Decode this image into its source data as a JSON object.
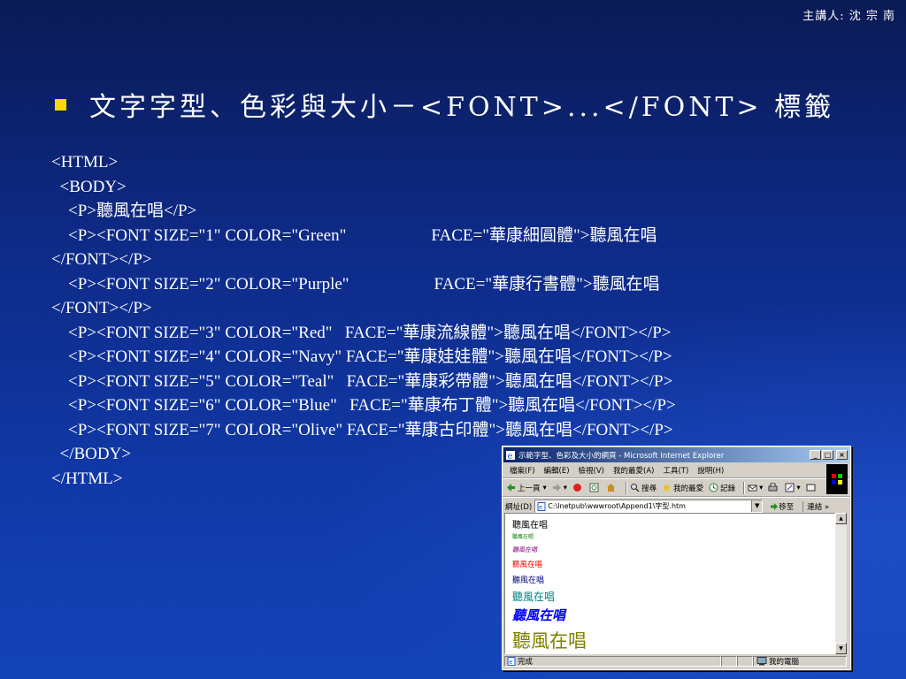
{
  "slide": {
    "speaker": "主講人: 沈 宗 南",
    "title": "文字字型、色彩與大小－<FONT>...</FONT> 標籤"
  },
  "code": {
    "l1": "<HTML>",
    "l2": "  <BODY>",
    "l3": "    <P>聽風在唱</P>",
    "l4a": "    <P><FONT SIZE=\"1\" COLOR=\"Green\"",
    "l4b": "FACE=\"華康細圓體\">聽風在唱",
    "l5": "</FONT></P>",
    "l6a": "    <P><FONT SIZE=\"2\" COLOR=\"Purple\"",
    "l6b": "FACE=\"華康行書體\">聽風在唱",
    "l7": "</FONT></P>",
    "l8": "    <P><FONT SIZE=\"3\" COLOR=\"Red\"   FACE=\"華康流線體\">聽風在唱</FONT></P>",
    "l9": "    <P><FONT SIZE=\"4\" COLOR=\"Navy\" FACE=\"華康娃娃體\">聽風在唱</FONT></P>",
    "l10": "    <P><FONT SIZE=\"5\" COLOR=\"Teal\"   FACE=\"華康彩帶體\">聽風在唱</FONT></P>",
    "l11": "    <P><FONT SIZE=\"6\" COLOR=\"Blue\"   FACE=\"華康布丁體\">聽風在唱</FONT></P>",
    "l12": "    <P><FONT SIZE=\"7\" COLOR=\"Olive\" FACE=\"華康古印體\">聽風在唱</FONT></P>",
    "l13": "  </BODY>",
    "l14": "</HTML>"
  },
  "browser": {
    "title": "示範字型、色彩及大小的網頁 - Microsoft Internet Explorer",
    "menu": [
      "檔案(F)",
      "編輯(E)",
      "檢視(V)",
      "我的最愛(A)",
      "工具(T)",
      "說明(H)"
    ],
    "toolbar": {
      "back": "上一頁",
      "search": "搜尋",
      "favorites": "我的最愛",
      "history": "記錄"
    },
    "address_label": "網址(D)",
    "address": "C:\\Inetpub\\wwwroot\\Append1\\字型.htm",
    "go": "移至",
    "links": "連結",
    "status_left": "完成",
    "status_right": "我的電腦",
    "page_lines": [
      {
        "text": "聽風在唱",
        "color": "#000000"
      },
      {
        "text": "聽風在唱",
        "color": "#008000"
      },
      {
        "text": "聽風在唱",
        "color": "#800080"
      },
      {
        "text": "聽風在唱",
        "color": "#ff0000"
      },
      {
        "text": "聽風在唱",
        "color": "#000080"
      },
      {
        "text": "聽風在唱",
        "color": "#008080"
      },
      {
        "text": "聽風在唱",
        "color": "#0000ff"
      },
      {
        "text": "聽風在唱",
        "color": "#808000"
      }
    ]
  },
  "colors": {
    "bullet": "#ffd800",
    "title_bar": "#0a246a"
  }
}
